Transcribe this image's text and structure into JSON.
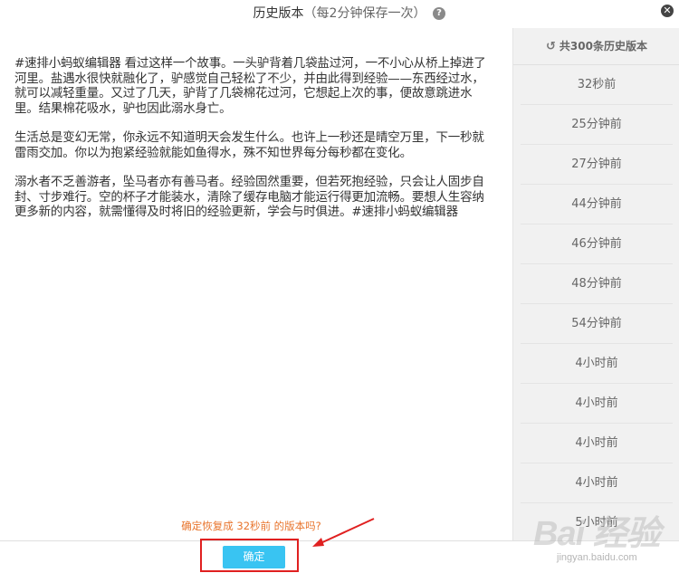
{
  "header": {
    "title": "历史版本",
    "subtitle": "（每2分钟保存一次）",
    "help_icon": "question-icon",
    "close_icon": "close-icon"
  },
  "content": {
    "paragraphs": [
      "#速排小蚂蚁编辑器 看过这样一个故事。一头驴背着几袋盐过河，一不小心从桥上掉进了河里。盐遇水很快就融化了，驴感觉自己轻松了不少，并由此得到经验——东西经过水，就可以减轻重量。又过了几天，驴背了几袋棉花过河，它想起上次的事，便故意跳进水里。结果棉花吸水，驴也因此溺水身亡。",
      "生活总是变幻无常，你永远不知道明天会发生什么。也许上一秒还是晴空万里，下一秒就雷雨交加。你以为抱紧经验就能如鱼得水，殊不知世界每分每秒都在变化。",
      "溺水者不乏善游者，坠马者亦有善马者。经验固然重要，但若死抱经验，只会让人固步自封、寸步难行。空的杯子才能装水，清除了缓存电脑才能运行得更加流畅。要想人生容纳更多新的内容，就需懂得及时将旧的经验更新，学会与时俱进。#速排小蚂蚁编辑器"
    ]
  },
  "sidebar": {
    "header_label": "共300条历史版本",
    "header_icon": "history-icon",
    "items": [
      "32秒前",
      "25分钟前",
      "27分钟前",
      "44分钟前",
      "46分钟前",
      "48分钟前",
      "54分钟前",
      "4小时前",
      "4小时前",
      "4小时前",
      "4小时前",
      "5小时前"
    ]
  },
  "footer": {
    "confirm_prompt": "确定恢复成 32秒前 的版本吗?",
    "confirm_button": "确定"
  },
  "watermark": {
    "main": "Bai 经验",
    "sub": "jingyan.baidu.com"
  },
  "colors": {
    "accent": "#39c4f2",
    "prompt": "#e8742c",
    "annotation": "#e02020"
  }
}
